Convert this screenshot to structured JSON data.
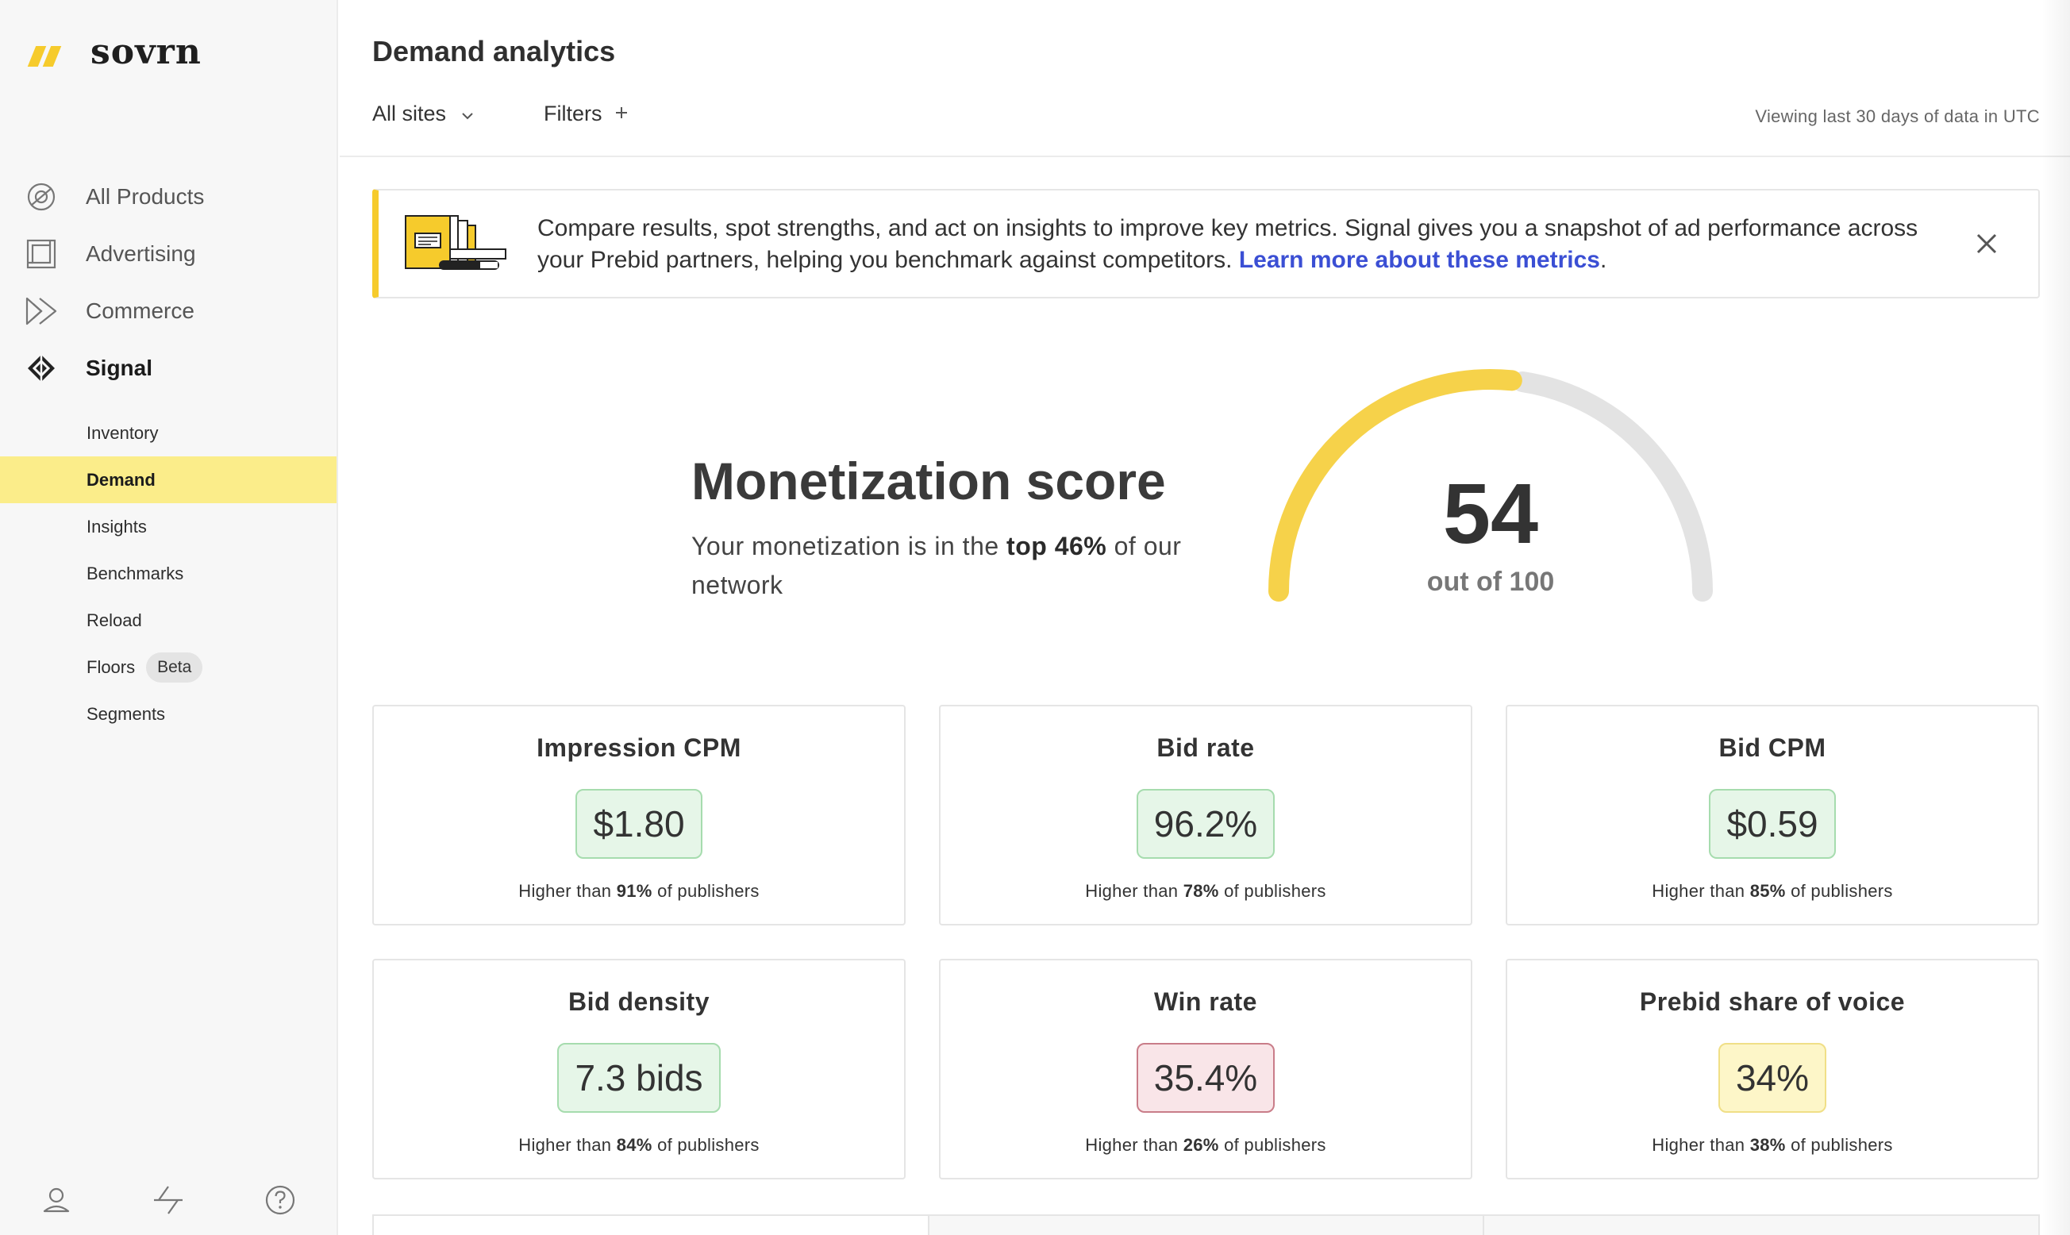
{
  "brand": {
    "name": "sovrn",
    "accent": "#f6cb2c"
  },
  "sidebar": {
    "main_items": [
      {
        "label": "All Products",
        "icon": "orbit-icon"
      },
      {
        "label": "Advertising",
        "icon": "layout-frame-icon"
      },
      {
        "label": "Commerce",
        "icon": "fast-forward-icon"
      },
      {
        "label": "Signal",
        "icon": "signal-diamond-icon",
        "active": true
      }
    ],
    "sub_items": [
      {
        "label": "Inventory"
      },
      {
        "label": "Demand",
        "active": true
      },
      {
        "label": "Insights"
      },
      {
        "label": "Benchmarks"
      },
      {
        "label": "Reload"
      },
      {
        "label": "Floors",
        "badge": "Beta"
      },
      {
        "label": "Segments"
      }
    ],
    "footer_icons": [
      "user-icon",
      "activity-icon",
      "help-icon"
    ]
  },
  "header": {
    "title": "Demand analytics",
    "sites_select": "All sites",
    "filters_label": "Filters",
    "viewing_text": "Viewing last 30 days of data in UTC"
  },
  "banner": {
    "text": "Compare results, spot strengths, and act on insights to improve key metrics. Signal gives you a snapshot of ad performance across your Prebid partners, helping you benchmark against competitors.",
    "link": "Learn more about these metrics",
    "after_link": "."
  },
  "score": {
    "heading": "Monetization score",
    "desc_prefix": "Your monetization is in the ",
    "desc_bold": "top 46%",
    "desc_suffix": " of our network",
    "value": "54",
    "value_number": 54,
    "max_label": "out of 100",
    "max": 100,
    "fill_color": "#f6d24a",
    "track_color": "#e3e3e3"
  },
  "metrics": [
    {
      "title": "Impression CPM",
      "value": "$1.80",
      "status": "good",
      "foot_prefix": "Higher than ",
      "foot_pct": "91%",
      "foot_suffix": " of publishers"
    },
    {
      "title": "Bid rate",
      "value": "96.2%",
      "status": "good",
      "foot_prefix": "Higher than ",
      "foot_pct": "78%",
      "foot_suffix": " of publishers"
    },
    {
      "title": "Bid CPM",
      "value": "$0.59",
      "status": "good",
      "foot_prefix": "Higher than ",
      "foot_pct": "85%",
      "foot_suffix": " of publishers"
    },
    {
      "title": "Bid density",
      "value": "7.3 bids",
      "status": "good",
      "foot_prefix": "Higher than ",
      "foot_pct": "84%",
      "foot_suffix": " of publishers"
    },
    {
      "title": "Win rate",
      "value": "35.4%",
      "status": "bad",
      "foot_prefix": "Higher than ",
      "foot_pct": "26%",
      "foot_suffix": " of publishers"
    },
    {
      "title": "Prebid share of voice",
      "value": "34%",
      "status": "mid",
      "foot_prefix": "Higher than ",
      "foot_pct": "38%",
      "foot_suffix": " of publishers"
    }
  ]
}
